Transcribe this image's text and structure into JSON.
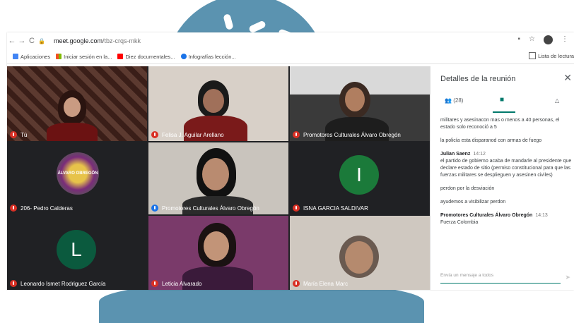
{
  "browser": {
    "url_host": "meet.google.com",
    "url_path": "/tbz-crqs-mkk",
    "bookmarks": [
      "Aplicaciones",
      "Iniciar sesión en la...",
      "Diez documentales...",
      "Infografías lección..."
    ],
    "reading_list": "Lista de lectura"
  },
  "tiles": [
    {
      "name": "Tú"
    },
    {
      "name": "Felisa J. Aguilar Arellano"
    },
    {
      "name": "Promotores Culturales Álvaro Obregón"
    },
    {
      "name": "206- Pedro Calderas",
      "poster_text": "ÁLVARO OBREGÓN"
    },
    {
      "name": "Promotores Culturales Álvaro Obregón"
    },
    {
      "name": "ISNA GARCIA SALDIVAR",
      "initial": "I"
    },
    {
      "name": "Leonardo Ismet Rodriguez García",
      "initial": "L"
    },
    {
      "name": "Leticia Alvarado"
    },
    {
      "name": "María Elena Marc"
    }
  ],
  "side": {
    "title": "Detalles de la reunión",
    "people_count": "(28)",
    "messages": [
      {
        "text": "militares y asesinacon mas o menos a 40 personas, el estado solo reconoció a 5"
      },
      {
        "text": "la policía esta disparanod con armas de fuego"
      },
      {
        "author": "Julian Saenz",
        "time": "14:12",
        "text": "el partido de gobierno acaba de mandarle al presidente que declare estado de sitio (permiso constitucional para que las fuerzas militares se desplieguen y asesinen civiles)"
      },
      {
        "text": "perdon por la desviación"
      },
      {
        "text": "ayudemos a visibilizar perdon"
      },
      {
        "author": "Promotores Culturales Álvaro Obregón",
        "time": "14:13",
        "text": "Fuerza Colombia"
      }
    ],
    "composer_placeholder": "Envía un mensaje a todos"
  },
  "colors": {
    "accent": "#00796b",
    "tile_bg": "#202124",
    "deco": "#5b93b0"
  }
}
